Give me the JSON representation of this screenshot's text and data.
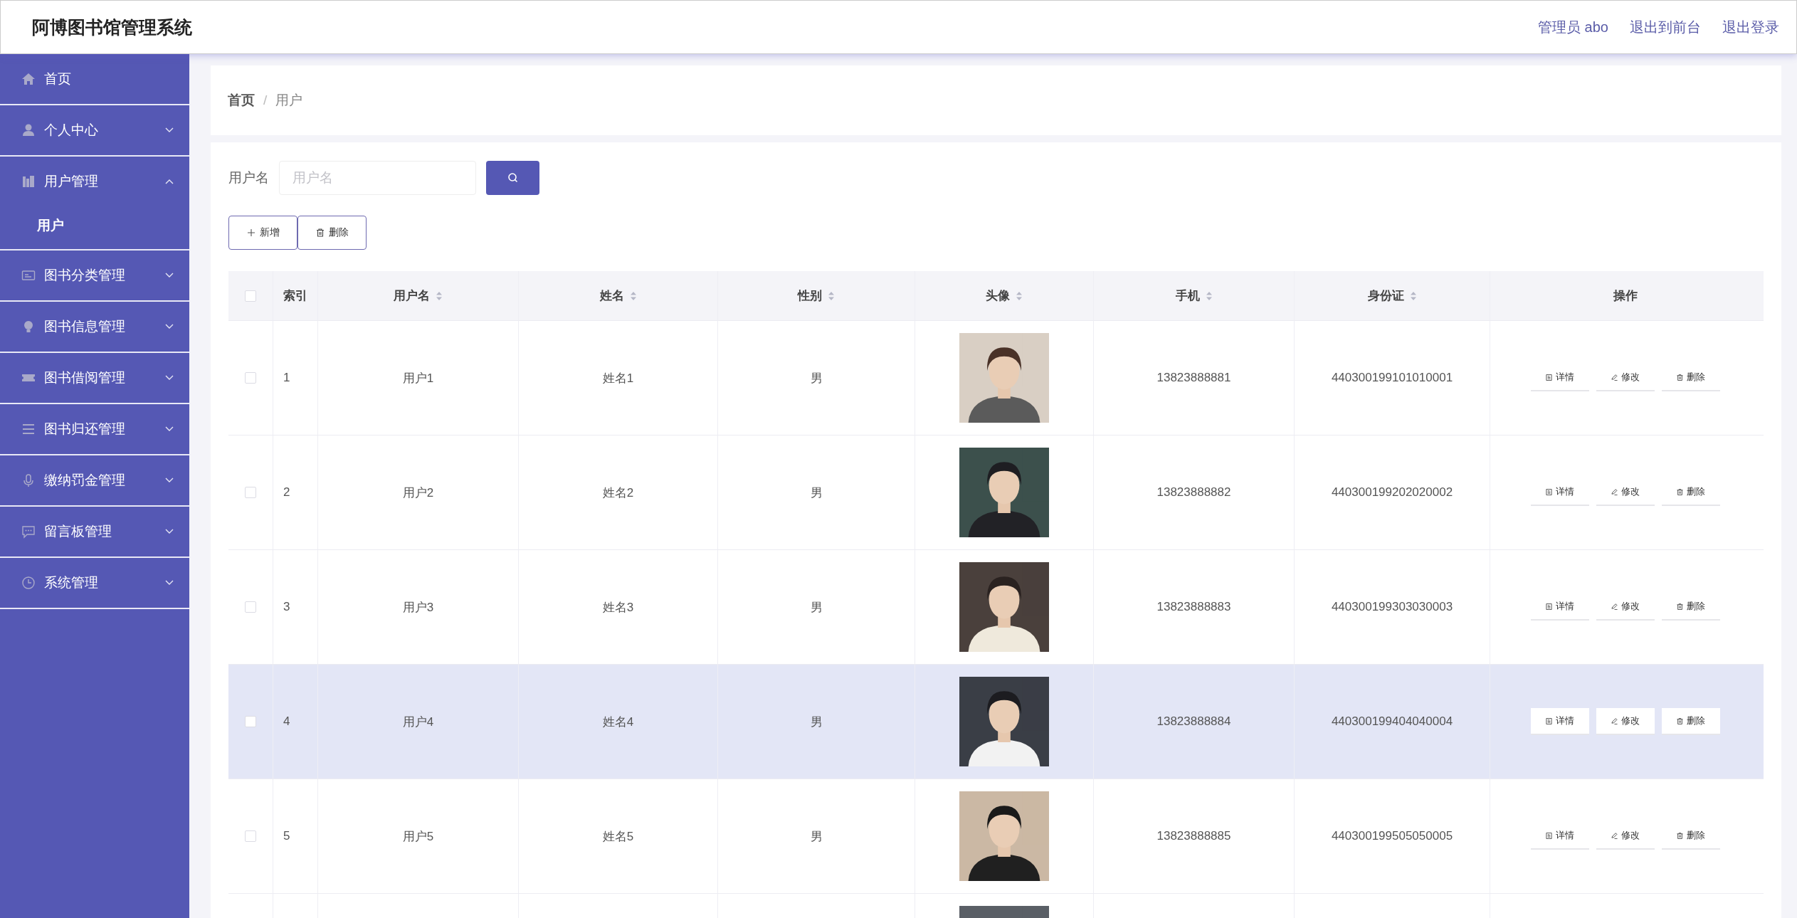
{
  "header": {
    "title": "阿博图书馆管理系统",
    "links": [
      "管理员 abo",
      "退出到前台",
      "退出登录"
    ]
  },
  "sidebar": {
    "items": [
      {
        "label": "首页"
      },
      {
        "label": "个人中心",
        "expanded": false
      },
      {
        "label": "用户管理",
        "expanded": true,
        "children": [
          {
            "label": "用户",
            "selected": true
          }
        ]
      },
      {
        "label": "图书分类管理",
        "expanded": false
      },
      {
        "label": "图书信息管理",
        "expanded": false
      },
      {
        "label": "图书借阅管理",
        "expanded": false
      },
      {
        "label": "图书归还管理",
        "expanded": false
      },
      {
        "label": "缴纳罚金管理",
        "expanded": false
      },
      {
        "label": "留言板管理",
        "expanded": false
      },
      {
        "label": "系统管理",
        "expanded": false
      }
    ]
  },
  "breadcrumb": {
    "items": [
      "首页",
      "用户"
    ],
    "separator": "/"
  },
  "search": {
    "label": "用户名",
    "placeholder": "用户名"
  },
  "toolbar": [
    {
      "label": "新增"
    },
    {
      "label": "删除"
    }
  ],
  "table": {
    "select_all_checked": false,
    "columns": [
      {
        "label": "索引",
        "sortable": false
      },
      {
        "label": "用户名",
        "sortable": true
      },
      {
        "label": "姓名",
        "sortable": true
      },
      {
        "label": "性别",
        "sortable": true
      },
      {
        "label": "头像",
        "sortable": true
      },
      {
        "label": "手机",
        "sortable": true
      },
      {
        "label": "身份证",
        "sortable": true
      },
      {
        "label": "操作",
        "sortable": false
      }
    ],
    "rows": [
      {
        "checked": false,
        "hovered": false,
        "index": "1",
        "username": "用户1",
        "name": "姓名1",
        "gender": "男",
        "avatar": {
          "kind": "picture"
        },
        "phone": "13823888881",
        "id_card": "440300199101010001",
        "actions": [
          "详情",
          "修改",
          "删除"
        ]
      },
      {
        "checked": false,
        "hovered": false,
        "index": "2",
        "username": "用户2",
        "name": "姓名2",
        "gender": "男",
        "avatar": {
          "kind": "picture"
        },
        "phone": "13823888882",
        "id_card": "440300199202020002",
        "actions": [
          "详情",
          "修改",
          "删除"
        ]
      },
      {
        "checked": false,
        "hovered": false,
        "index": "3",
        "username": "用户3",
        "name": "姓名3",
        "gender": "男",
        "avatar": {
          "kind": "picture"
        },
        "phone": "13823888883",
        "id_card": "440300199303030003",
        "actions": [
          "详情",
          "修改",
          "删除"
        ]
      },
      {
        "checked": false,
        "hovered": true,
        "index": "4",
        "username": "用户4",
        "name": "姓名4",
        "gender": "男",
        "avatar": {
          "kind": "picture"
        },
        "phone": "13823888884",
        "id_card": "440300199404040004",
        "actions": [
          "详情",
          "修改",
          "删除"
        ]
      },
      {
        "checked": false,
        "hovered": false,
        "index": "5",
        "username": "用户5",
        "name": "姓名5",
        "gender": "男",
        "avatar": {
          "kind": "picture"
        },
        "phone": "13823888885",
        "id_card": "440300199505050005",
        "actions": [
          "详情",
          "修改",
          "删除"
        ]
      },
      {
        "avatar": {
          "kind": "picture"
        }
      }
    ]
  }
}
